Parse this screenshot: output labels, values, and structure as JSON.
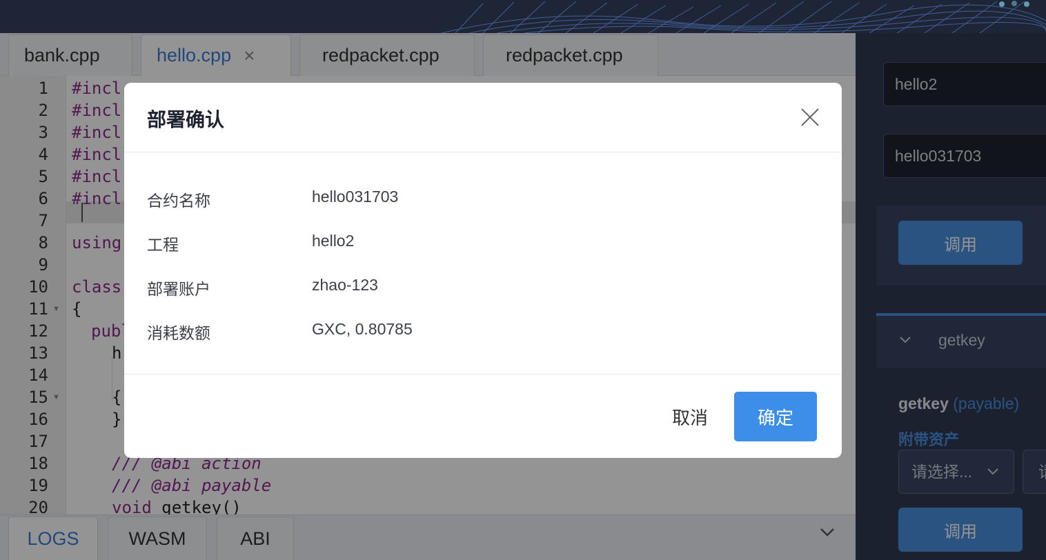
{
  "editor": {
    "tabs": [
      {
        "label": "bank.cpp"
      },
      {
        "label": "hello.cpp",
        "close": "×"
      },
      {
        "label": "redpacket.cpp"
      },
      {
        "label": "redpacket.cpp"
      }
    ],
    "line_numbers": [
      "1",
      "2",
      "3",
      "4",
      "5",
      "6",
      "7",
      "8",
      "9",
      "10",
      "11",
      "12",
      "13",
      "14",
      "15",
      "16",
      "17",
      "18",
      "19",
      "20"
    ],
    "code": {
      "l1": "#incl",
      "l2": "#incl",
      "l3": "#incl",
      "l4": "#incl",
      "l5": "#incl",
      "l6": "#incl",
      "l8": "using",
      "l10": "class",
      "l11": "{",
      "l12": "publ",
      "l13": "h",
      "l15": "{",
      "l16": "}",
      "l18": "/// @abi action",
      "l19": "/// @abi payable",
      "l20_kw": "void",
      "l20_rest": " getkey()"
    },
    "bottom_tabs": [
      "LOGS",
      "WASM",
      "ABI"
    ]
  },
  "right_panel": {
    "project_input": "hello2",
    "contract_input": "hello031703",
    "call_button": "调用",
    "function_header": "getkey",
    "function_title": "getkey",
    "function_payable": "(payable)",
    "attach_asset_label": "附带资产",
    "select_placeholder": "请选择...",
    "select2_placeholder": "请",
    "call_button2": "调用"
  },
  "modal": {
    "title": "部署确认",
    "rows": [
      {
        "label": "合约名称",
        "value": "hello031703"
      },
      {
        "label": "工程",
        "value": "hello2"
      },
      {
        "label": "部署账户",
        "value": "zhao-123"
      },
      {
        "label": "消耗数额",
        "value": "GXC, 0.80785"
      }
    ],
    "cancel": "取消",
    "confirm": "确定"
  },
  "colors": {
    "accent": "#3d8ee8",
    "dark_bg": "#2f3a52",
    "keyword": "#8e2a8e"
  }
}
